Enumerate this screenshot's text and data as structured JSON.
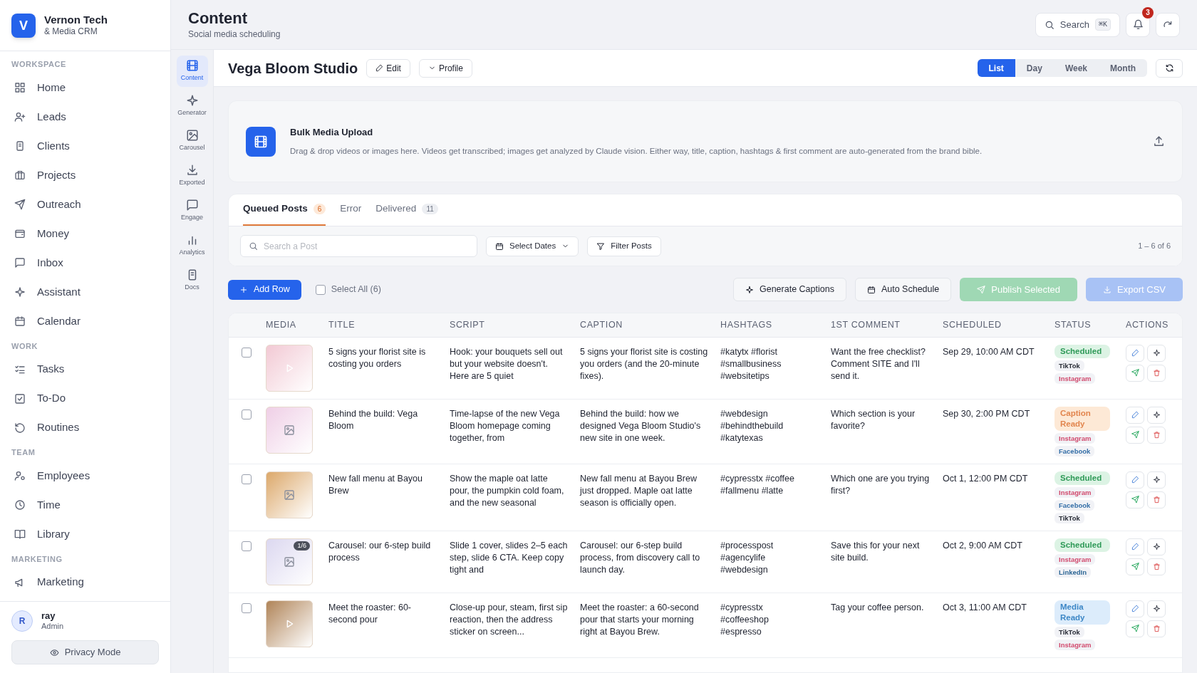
{
  "brand": {
    "logo_letter": "V",
    "name": "Vernon Tech",
    "subtitle": "& Media CRM"
  },
  "sidebar": {
    "sections": [
      {
        "title": "WORKSPACE",
        "items": [
          {
            "label": "Home",
            "selected": false
          },
          {
            "label": "Leads",
            "selected": false
          },
          {
            "label": "Clients",
            "selected": false
          },
          {
            "label": "Projects",
            "selected": false
          },
          {
            "label": "Outreach",
            "selected": false
          },
          {
            "label": "Money",
            "selected": false
          },
          {
            "label": "Inbox",
            "selected": false
          },
          {
            "label": "Assistant",
            "selected": false
          },
          {
            "label": "Calendar",
            "selected": false
          }
        ]
      },
      {
        "title": "WORK",
        "items": [
          {
            "label": "Tasks",
            "selected": false
          },
          {
            "label": "To-Do",
            "selected": false
          },
          {
            "label": "Routines",
            "selected": false
          }
        ]
      },
      {
        "title": "TEAM",
        "items": [
          {
            "label": "Employees",
            "selected": false
          },
          {
            "label": "Time",
            "selected": false
          },
          {
            "label": "Library",
            "selected": false
          }
        ]
      },
      {
        "title": "MARKETING",
        "items": [
          {
            "label": "Marketing",
            "selected": false
          }
        ]
      }
    ]
  },
  "user": {
    "initial": "R",
    "name": "ray",
    "role": "Admin"
  },
  "privacy_button": "Privacy Mode",
  "header": {
    "title": "Content",
    "subtitle": "Social media scheduling",
    "search": "Search",
    "shortcut": "⌘K",
    "notifications": "3"
  },
  "rail": [
    {
      "label": "Content",
      "selected": true
    },
    {
      "label": "Generator",
      "selected": false
    },
    {
      "label": "Carousel",
      "selected": false
    },
    {
      "label": "Exported",
      "selected": false
    },
    {
      "label": "Engage",
      "selected": false
    },
    {
      "label": "Analytics",
      "selected": false
    },
    {
      "label": "Docs",
      "selected": false
    }
  ],
  "client": {
    "name": "Vega Bloom Studio",
    "edit": "Edit",
    "profile": "Profile"
  },
  "views": [
    {
      "label": "List",
      "selected": true
    },
    {
      "label": "Day",
      "selected": false
    },
    {
      "label": "Week",
      "selected": false
    },
    {
      "label": "Month",
      "selected": false
    }
  ],
  "upload": {
    "title": "Bulk Media Upload",
    "description": "Drag & drop videos or images here. Videos get transcribed; images get analyzed by Claude vision. Either way, title, caption, hashtags & first comment are auto-generated from the brand bible."
  },
  "tabs": [
    {
      "label": "Queued Posts",
      "count": "6",
      "selected": true
    },
    {
      "label": "Error",
      "selected": false
    },
    {
      "label": "Delivered",
      "count": "11",
      "selected": false
    }
  ],
  "filters": {
    "search_placeholder": "Search a Post",
    "dates": "Select Dates",
    "filter": "Filter Posts",
    "range": "1 – 6 of 6"
  },
  "actions": {
    "add_row": "Add Row",
    "select_all": {
      "label": "Select All (6)",
      "checked": false
    },
    "generate": "Generate Captions",
    "auto_schedule": "Auto Schedule",
    "publish": {
      "label": "Publish Selected",
      "disabled": true
    },
    "export": {
      "label": "Export CSV",
      "disabled": true
    }
  },
  "table": {
    "columns": [
      "MEDIA",
      "TITLE",
      "SCRIPT",
      "CAPTION",
      "HASHTAGS",
      "1ST COMMENT",
      "SCHEDULED",
      "STATUS",
      "ACTIONS"
    ],
    "rows": [
      {
        "checked": false,
        "media": {
          "kind": "video",
          "color": "#f2c9d4"
        },
        "title": "5 signs your florist site is costing you orders",
        "script": "Hook: your bouquets sell out but your website doesn't. Here are 5 quiet",
        "caption": "5 signs your florist site is costing you orders (and the 20-minute fixes).",
        "hashtags": [
          "#katytx #florist",
          "#smallbusiness",
          "#websitetips"
        ],
        "comment": "Want the free checklist? Comment SITE and I'll send it.",
        "scheduled": "Sep 29, 10:00 AM CDT",
        "status": {
          "kind": "scheduled",
          "label": "Scheduled"
        },
        "platforms": [
          {
            "kind": "tiktok",
            "label": "TikTok"
          },
          {
            "kind": "instagram",
            "label": "Instagram"
          }
        ]
      },
      {
        "checked": false,
        "media": {
          "kind": "image",
          "color": "#efcfe6"
        },
        "title": "Behind the build: Vega Bloom",
        "script": "Time-lapse of the new Vega Bloom homepage coming together, from",
        "caption": "Behind the build: how we designed Vega Bloom Studio's new site in one week.",
        "hashtags": [
          "#webdesign",
          "#behindthebuild",
          "#katytexas"
        ],
        "comment": "Which section is your favorite?",
        "scheduled": "Sep 30, 2:00 PM CDT",
        "status": {
          "kind": "caption_ready",
          "label": "Caption Ready"
        },
        "platforms": [
          {
            "kind": "instagram",
            "label": "Instagram"
          },
          {
            "kind": "facebook",
            "label": "Facebook"
          }
        ]
      },
      {
        "checked": false,
        "media": {
          "kind": "image",
          "color": "#dca86a"
        },
        "title": "New fall menu at Bayou Brew",
        "script": "Show the maple oat latte pour, the pumpkin cold foam, and the new seasonal",
        "caption": "New fall menu at Bayou Brew just dropped. Maple oat latte season is officially open.",
        "hashtags": [
          "#cypresstx #coffee",
          "#fallmenu #latte"
        ],
        "comment": "Which one are you trying first?",
        "scheduled": "Oct 1, 12:00 PM CDT",
        "status": {
          "kind": "scheduled",
          "label": "Scheduled"
        },
        "platforms": [
          {
            "kind": "instagram",
            "label": "Instagram"
          },
          {
            "kind": "facebook",
            "label": "Facebook"
          },
          {
            "kind": "tiktok",
            "label": "TikTok"
          }
        ]
      },
      {
        "checked": false,
        "media": {
          "kind": "image",
          "color": "#dcd8f0",
          "badge": "1/6"
        },
        "title": "Carousel: our 6-step build process",
        "script": "Slide 1 cover, slides 2–5 each step, slide 6 CTA. Keep copy tight and",
        "caption": "Carousel: our 6-step build process, from discovery call to launch day.",
        "hashtags": [
          "#processpost",
          "#agencylife",
          "#webdesign"
        ],
        "comment": "Save this for your next site build.",
        "scheduled": "Oct 2, 9:00 AM CDT",
        "status": {
          "kind": "scheduled",
          "label": "Scheduled"
        },
        "platforms": [
          {
            "kind": "instagram",
            "label": "Instagram"
          },
          {
            "kind": "linkedin",
            "label": "LinkedIn"
          }
        ]
      },
      {
        "checked": false,
        "media": {
          "kind": "video",
          "color": "#b08458"
        },
        "title": "Meet the roaster: 60-second pour",
        "script": "Close-up pour, steam, first sip reaction, then the address sticker on screen...",
        "caption": "Meet the roaster: a 60-second pour that starts your morning right at Bayou Brew.",
        "hashtags": [
          "#cypresstx",
          "#coffeeshop",
          "#espresso"
        ],
        "comment": "Tag your coffee person.",
        "scheduled": "Oct 3, 11:00 AM CDT",
        "status": {
          "kind": "media_ready",
          "label": "Media Ready"
        },
        "platforms": [
          {
            "kind": "tiktok",
            "label": "TikTok"
          },
          {
            "kind": "instagram",
            "label": "Instagram"
          }
        ]
      }
    ]
  }
}
